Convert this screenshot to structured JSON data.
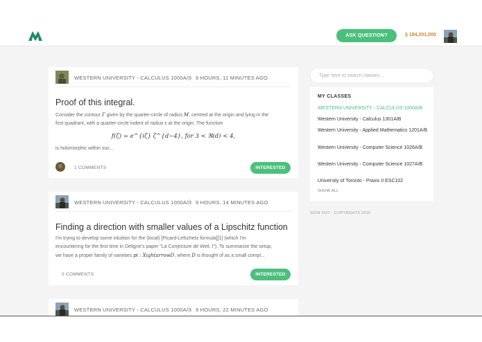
{
  "header": {
    "ask_button": "ASK QUESTION?",
    "credits": "§ 184,201,000"
  },
  "questions": [
    {
      "class": "WESTERN UNIVERSITY - CALCULUS 1000A/B",
      "time": "9 HOURS, 11 MINUTES AGO",
      "title": "Proof of this integral.",
      "body_line1_a": "Consider the contour ",
      "body_line1_sym": "Γ",
      "body_line1_b": " given by the quarter-circle of radius ",
      "body_line1_sym2": "M",
      "body_line1_c": ", centred at the origin and lying in the",
      "body_line2": "first quadrant, with a quarter-circle indent of radius ε at the origin. The function",
      "math": "f(ζ) = e^{iζ} ζ^{d−4},  for 3 < ℜ(d) < 4,",
      "after": "is holomorphic within suc...",
      "comments": "1 COMMENTS",
      "action": "INTERESTED"
    },
    {
      "class": "WESTERN UNIVERSITY - CALCULUS 1000A/B",
      "time": "9 HOURS, 14 MINUTES AGO",
      "title": "Finding a direction with smaller values of a Lipschitz function",
      "body_line1": "I'm trying to develop some intuition for the (local) [Picard-Lefschetz formula][1] (which I'm",
      "body_line2": "encountering for the first time in Deligne's paper \"La Conjecture de Weil, I\"). To summarize the setup,",
      "body_line3_a": "we have a proper family of varieties ",
      "body_line3_sym": "pi : XightarrowD",
      "body_line3_b": ", where ",
      "body_line3_sym2": "D",
      "body_line3_c": " is thought of as a small compl...",
      "comments": "0 COMMENTS",
      "action": "INTERESTED"
    },
    {
      "class": "WESTERN UNIVERSITY - CALCULUS 1000A/B",
      "time": "9 HOURS, 22 MINUTES AGO"
    }
  ],
  "sidebar": {
    "search_placeholder": "Type here to search classes...",
    "title": "MY CLASSES",
    "classes": [
      "WESTERN UNIVERSITY - CALCULUS 1000A/B",
      "Western University - Calculus 1301A/B",
      "Western University - Applied Mathematics 1201A/B",
      "Western University - Computer Science 1026A/B",
      "Western University - Computer Science 1027A/B",
      "University of Toronto - Praxis II ESC102"
    ],
    "show_all": "SHOW ALL",
    "footer": "SIGN OUT · COPYRGHTS 2016"
  },
  "colors": {
    "accent": "#4cbf7d",
    "credits": "#c98a2a",
    "logo": "#1f8a70"
  },
  "icons": {
    "logo": "m-logo-icon",
    "avatar": "user-avatar"
  }
}
